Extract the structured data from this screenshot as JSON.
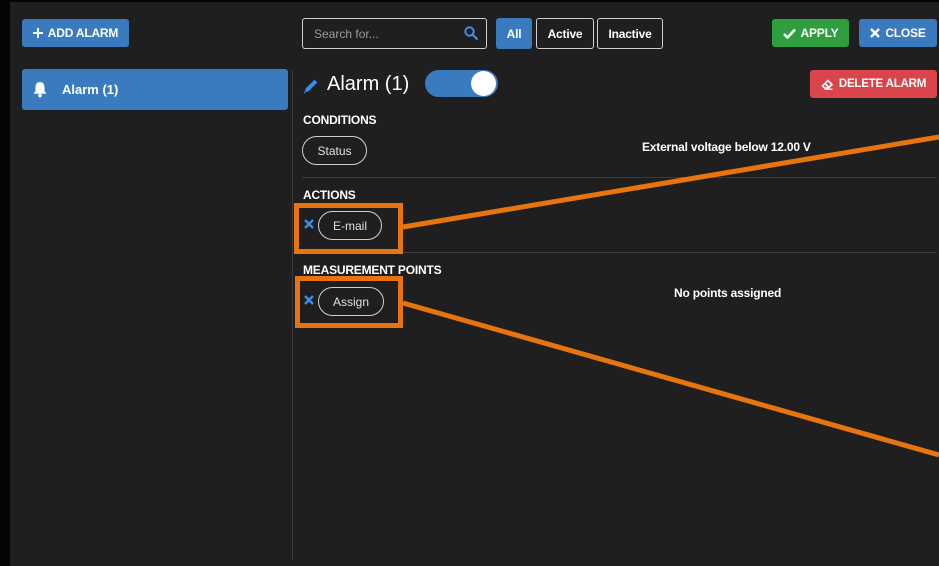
{
  "toolbar": {
    "add_alarm_label": "ADD ALARM",
    "search_placeholder": "Search for...",
    "filters": {
      "all": "All",
      "active": "Active",
      "inactive": "Inactive"
    },
    "selected_filter": "All",
    "apply_label": "APPLY",
    "close_label": "CLOSE"
  },
  "sidebar": {
    "items": [
      {
        "label": "Alarm (1)",
        "icon": "bell-icon"
      }
    ]
  },
  "detail": {
    "title": "Alarm (1)",
    "enabled": true,
    "delete_label": "DELETE ALARM",
    "conditions": {
      "heading": "CONDITIONS",
      "button_label": "Status",
      "description": "External voltage below 12.00 V"
    },
    "actions": {
      "heading": "ACTIONS",
      "button_label": "E-mail"
    },
    "measurement_points": {
      "heading": "MEASUREMENT POINTS",
      "button_label": "Assign",
      "description": "No points assigned"
    }
  },
  "colors": {
    "primary": "#3a7bbf",
    "success": "#2e9e3e",
    "danger": "#d9454a",
    "highlight": "#e8740f",
    "background": "#1f1f1f"
  }
}
